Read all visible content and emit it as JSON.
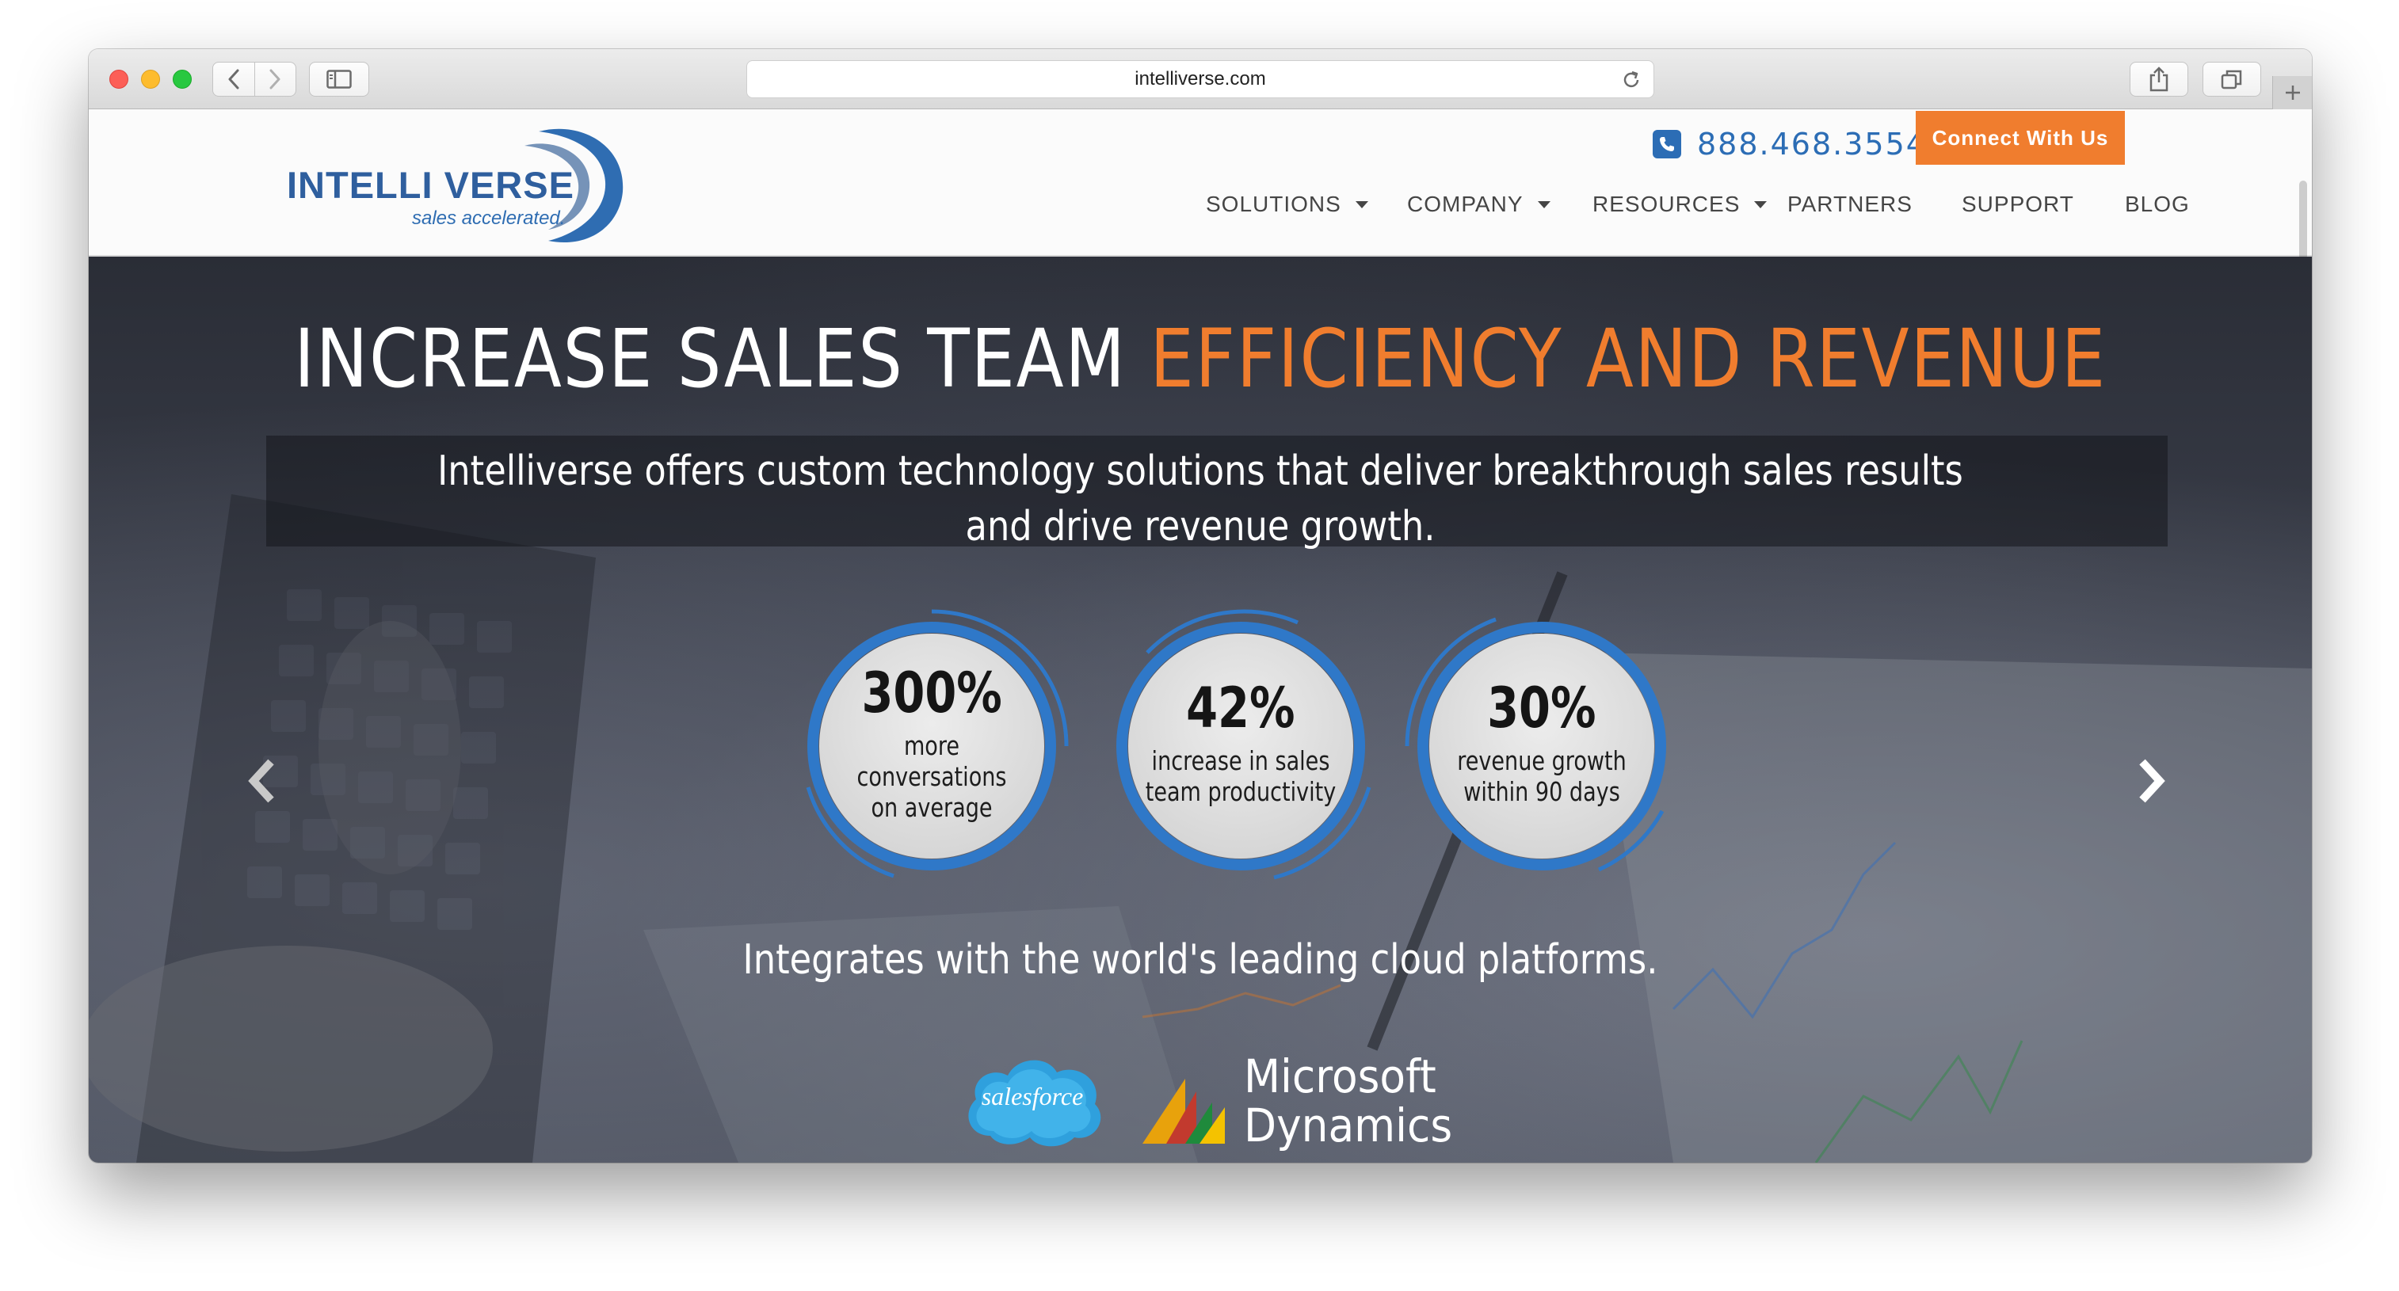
{
  "browser": {
    "url": "intelliverse.com",
    "icons": [
      "back-icon",
      "forward-icon",
      "sidebar-icon",
      "reload-icon",
      "share-icon",
      "tabs-icon",
      "plus-icon"
    ]
  },
  "header": {
    "logo_text": "INTELLI VERSE",
    "logo_tagline": "sales accelerated.",
    "phone": "888.468.3554",
    "cta_label": "Connect With Us",
    "nav": [
      {
        "label": "SOLUTIONS",
        "dropdown": true
      },
      {
        "label": "COMPANY",
        "dropdown": true
      },
      {
        "label": "RESOURCES",
        "dropdown": true
      },
      {
        "label": "PARTNERS",
        "dropdown": false
      },
      {
        "label": "SUPPORT",
        "dropdown": false
      },
      {
        "label": "BLOG",
        "dropdown": false
      }
    ]
  },
  "hero": {
    "headline_white": "INCREASE SALES TEAM ",
    "headline_accent": "EFFICIENCY AND REVENUE",
    "subheadline_line1": "Intelliverse offers custom technology solutions that deliver breakthrough sales results",
    "subheadline_line2": "and drive revenue growth.",
    "stats": [
      {
        "value": "300%",
        "label_line1": "more conversations",
        "label_line2": "on average"
      },
      {
        "value": "42%",
        "label_line1": "increase in sales",
        "label_line2": "team productivity"
      },
      {
        "value": "30%",
        "label_line1": "revenue growth",
        "label_line2": "within 90 days"
      }
    ],
    "integrates_text": "Integrates with the world's leading cloud platforms.",
    "partner_logos": {
      "salesforce": "salesforce",
      "microsoft_line1": "Microsoft",
      "microsoft_line2": "Dynamics"
    }
  },
  "colors": {
    "accent_orange": "#f07d2e",
    "brand_blue": "#2c6db5",
    "ring_blue": "#2f78c8"
  }
}
